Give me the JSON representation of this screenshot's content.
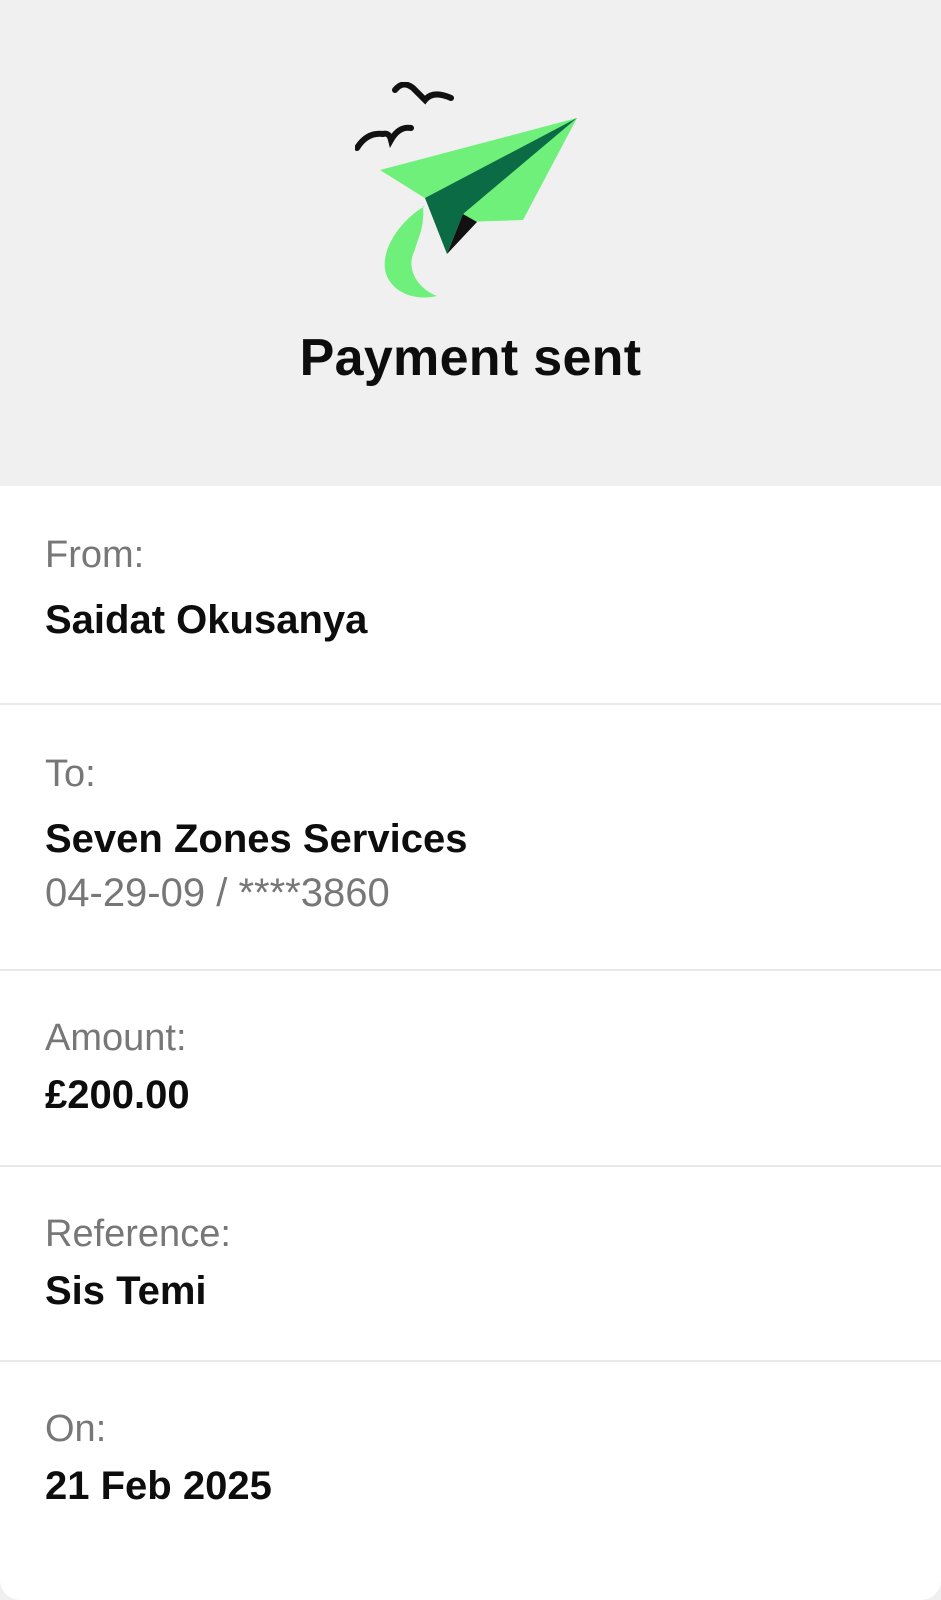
{
  "header": {
    "title": "Payment sent",
    "illustration": "paper-plane-with-birds",
    "colors": {
      "plane_light": "#6ef07a",
      "plane_dark": "#0a6b45",
      "birds": "#111111"
    }
  },
  "details": {
    "from": {
      "label": "From:",
      "value": "Saidat Okusanya"
    },
    "to": {
      "label": "To:",
      "value": "Seven Zones Services",
      "account": "04-29-09 / ****3860"
    },
    "amount": {
      "label": "Amount:",
      "value": "£200.00"
    },
    "reference": {
      "label": "Reference:",
      "value": "Sis Temi"
    },
    "on": {
      "label": "On:",
      "value": "21 Feb 2025"
    }
  }
}
